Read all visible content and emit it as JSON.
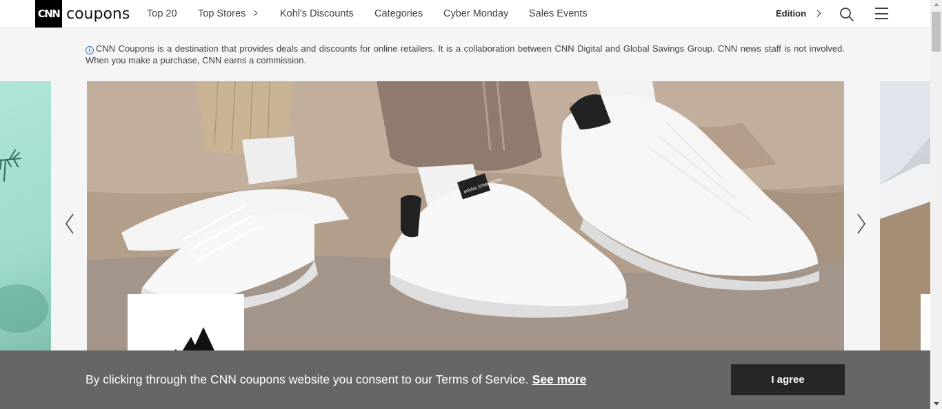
{
  "header": {
    "logo_mark": "CNN",
    "logo_word": "coupons",
    "nav": [
      {
        "label": "Top 20"
      },
      {
        "label": "Top Stores"
      },
      {
        "label": "Kohl's Discounts"
      },
      {
        "label": "Categories"
      },
      {
        "label": "Cyber Monday"
      },
      {
        "label": "Sales Events"
      }
    ],
    "edition_label": "Edition"
  },
  "disclaimer": {
    "icon": "i",
    "text": "CNN Coupons is a destination that provides deals and discounts for online retailers. It is a collaboration between CNN Digital and Global Savings Group. CNN news staff is not involved. When you make a purchase, CNN earns a commission."
  },
  "carousel": {
    "shoe_logo_text": "adidas STAN SMITH"
  },
  "cookie_bar": {
    "text": "By clicking through the CNN coupons website you consent to our Terms of Service.",
    "link_label": "See more",
    "agree_label": "I agree"
  }
}
